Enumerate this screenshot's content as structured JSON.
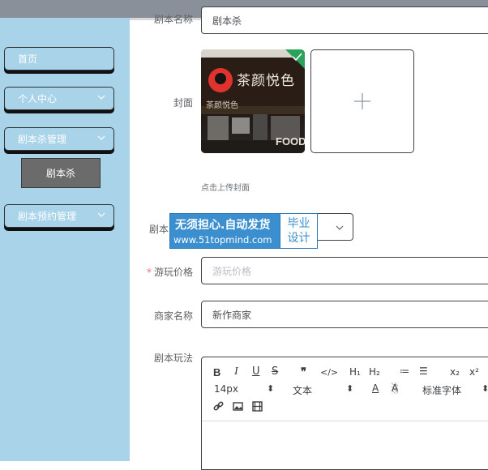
{
  "sidebar": {
    "items": [
      {
        "label": "首页"
      },
      {
        "label": "个人中心"
      },
      {
        "label": "剧本杀管理"
      },
      {
        "label": "剧本预约管理"
      }
    ],
    "submenu_active": "剧本杀"
  },
  "form": {
    "name_label": "剧本名称",
    "name_value": "剧本杀",
    "cover_label": "封面",
    "cover_hint": "点击上传封面",
    "type_label_partial": "剧本",
    "price_label": "游玩价格",
    "price_required": "*",
    "price_placeholder": "游玩价格",
    "merchant_label": "商家名称",
    "merchant_value": "新作商家",
    "gameplay_label": "剧本玩法"
  },
  "cover_image": {
    "sign_text": "茶颜悦色",
    "sign_small": "茶颜悦色"
  },
  "watermark": {
    "line1": "无须担心.自动发货",
    "line2": "www.51topmind.com",
    "right_line1": "毕业",
    "right_line2": "设计"
  },
  "editor": {
    "toolbar_row1": [
      "B",
      "I",
      "U",
      "S",
      "❞",
      "</>",
      "H₁",
      "H₂",
      "≔",
      "☰",
      "x₂",
      "x²"
    ],
    "font_size": "14px",
    "text_style": "文本",
    "font_family": "标准字体",
    "font_color_icon": "A",
    "bg_color_icon": "A"
  },
  "colors": {
    "sidebar_bg": "#a9d3e9",
    "topbar_bg": "#8a9099",
    "watermark_blue": "#3c8fcf",
    "submenu_active_bg": "#6b6b6b"
  }
}
